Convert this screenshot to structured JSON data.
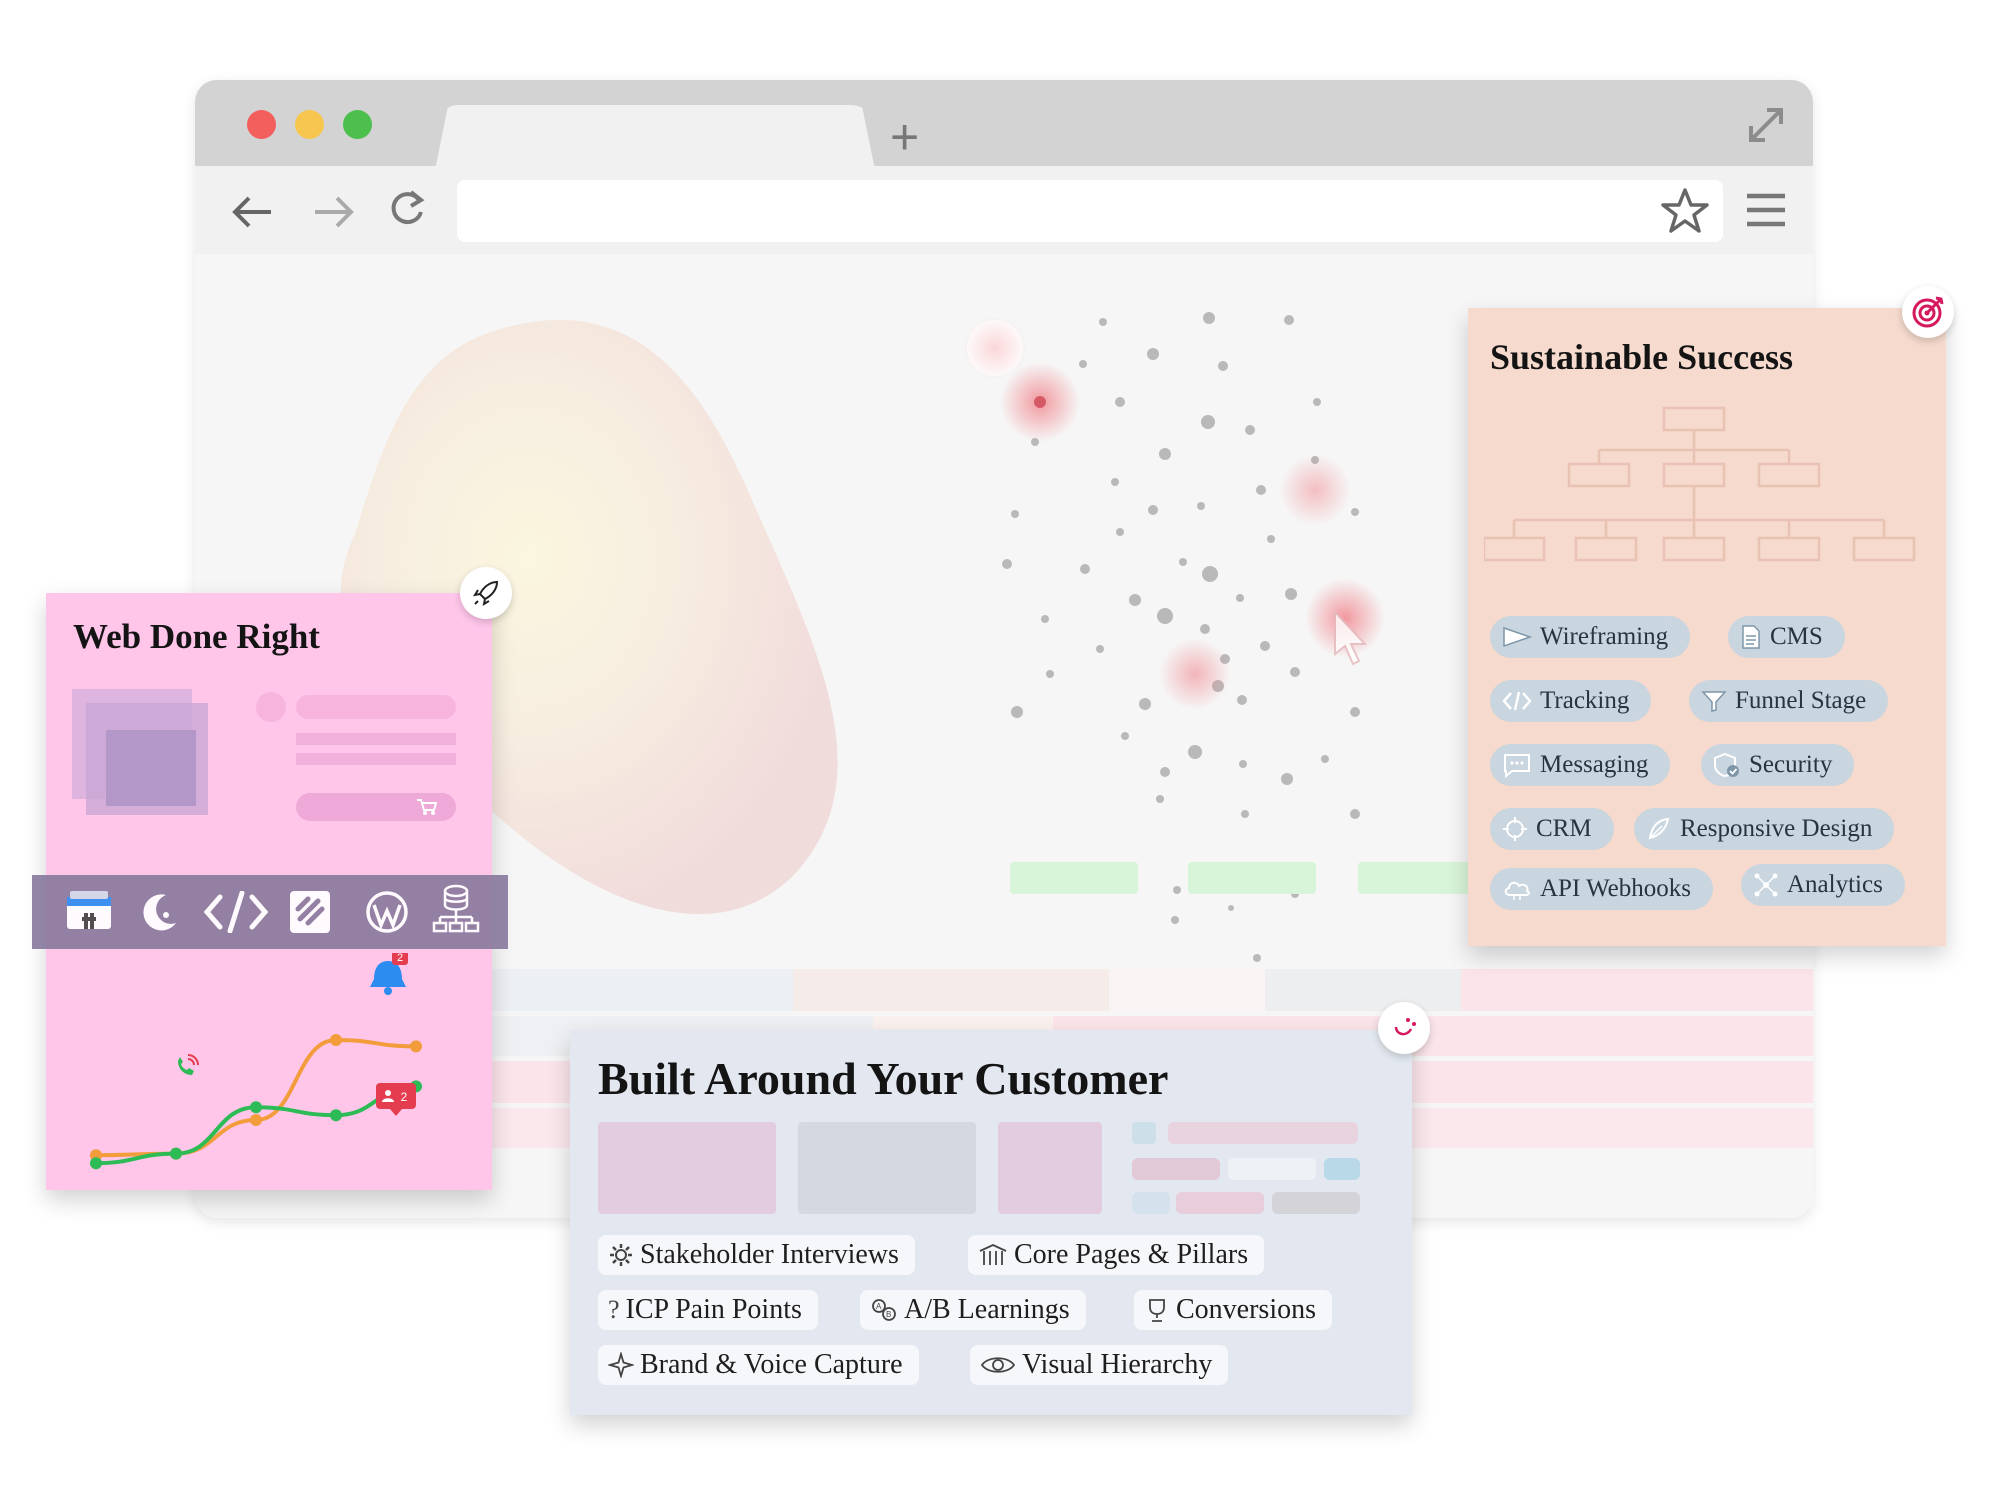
{
  "browser": {
    "traffic_lights": {
      "close": "#f25f5c",
      "minimize": "#f7c64f",
      "maximize": "#4cbf4c"
    },
    "new_tab_symbol": "+",
    "url_value": ""
  },
  "web_card": {
    "title": "Web Done Right",
    "bg": "#ffc6ea",
    "tech_icons": [
      "google-search-console-icon",
      "moon-icon",
      "code-icon",
      "hubspot-icon",
      "wordpress-icon",
      "database-icon"
    ],
    "notification_count": "2",
    "users_badge_count": "2",
    "chart": {
      "series": [
        {
          "color": "#f39c3c",
          "values": [
            0.08,
            0.09,
            0.3,
            0.8,
            0.76
          ]
        },
        {
          "color": "#2dbb56",
          "values": [
            0.03,
            0.09,
            0.38,
            0.33,
            0.51
          ]
        }
      ]
    }
  },
  "success_card": {
    "title": "Sustainable Success",
    "bg": "#f5dacd",
    "chips": [
      {
        "label": "Wireframing",
        "icon": "flag-icon"
      },
      {
        "label": "CMS",
        "icon": "document-icon"
      },
      {
        "label": "Tracking",
        "icon": "code-icon"
      },
      {
        "label": "Funnel Stage",
        "icon": "funnel-icon"
      },
      {
        "label": "Messaging",
        "icon": "chat-icon"
      },
      {
        "label": "Security",
        "icon": "shield-icon"
      },
      {
        "label": "CRM",
        "icon": "crosshair-icon"
      },
      {
        "label": "Responsive Design",
        "icon": "feather-icon"
      },
      {
        "label": "API Webhooks",
        "icon": "cloud-icon"
      },
      {
        "label": "Analytics",
        "icon": "network-icon"
      }
    ]
  },
  "customer_card": {
    "title": "Built Around Your Customer",
    "bg": "#e3e8f0",
    "pills": [
      {
        "label": "Stakeholder Interviews",
        "icon": "gear-icon"
      },
      {
        "label": "Core Pages & Pillars",
        "icon": "pillars-icon"
      },
      {
        "label": "ICP Pain Points",
        "icon": "question-icon"
      },
      {
        "label": "A/B Learnings",
        "icon": "ab-icon"
      },
      {
        "label": "Conversions",
        "icon": "trophy-icon"
      },
      {
        "label": "Brand & Voice Capture",
        "icon": "sparkle-icon"
      },
      {
        "label": "Visual Hierarchy",
        "icon": "eye-icon"
      }
    ]
  },
  "colors": {
    "accent": "#d6195f",
    "chip_bg": "#c9d5df",
    "toolbar_strip": "#8a7b9e"
  }
}
